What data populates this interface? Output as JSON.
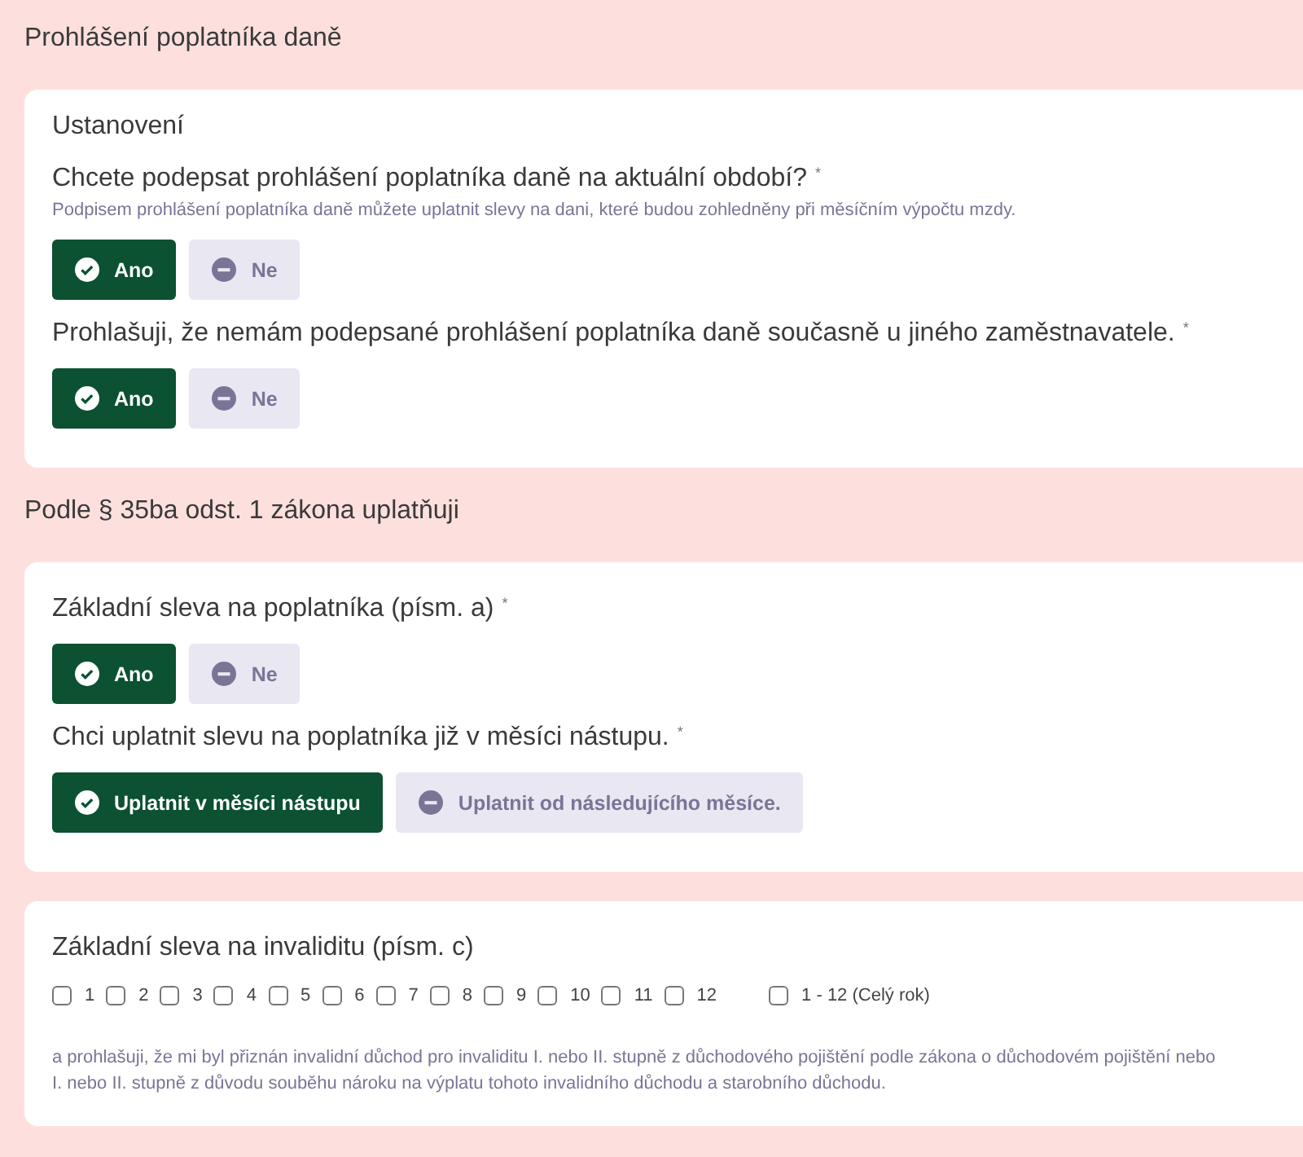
{
  "sections": [
    {
      "title": "Prohlášení poplatníka daně",
      "cards": [
        {
          "title": "Ustanovení",
          "questions": [
            {
              "kind": "choice",
              "label": "Chcete podepsat prohlášení poplatníka daně na aktuální období?",
              "required_mark": "*",
              "hint": "Podpisem prohlášení poplatníka daně můžete uplatnit slevy na dani, které budou zohledněny při měsíčním výpočtu mzdy.",
              "options": [
                {
                  "label": "Ano",
                  "selected": true
                },
                {
                  "label": "Ne",
                  "selected": false
                }
              ]
            },
            {
              "kind": "choice",
              "label": "Prohlašuji, že nemám podepsané prohlášení poplatníka daně současně u jiného zaměstnavatele.",
              "required_mark": "*",
              "options": [
                {
                  "label": "Ano",
                  "selected": true
                },
                {
                  "label": "Ne",
                  "selected": false
                }
              ]
            }
          ]
        }
      ]
    },
    {
      "title": "Podle § 35ba odst. 1 zákona uplatňuji",
      "cards": [
        {
          "questions": [
            {
              "kind": "choice",
              "label": "Základní sleva na poplatníka (písm. a)",
              "required_mark": "*",
              "options": [
                {
                  "label": "Ano",
                  "selected": true
                },
                {
                  "label": "Ne",
                  "selected": false
                }
              ]
            },
            {
              "kind": "choice",
              "label": "Chci uplatnit slevu na poplatníka již v měsíci nástupu.",
              "required_mark": "*",
              "options": [
                {
                  "label": "Uplatnit v měsíci nástupu",
                  "selected": true
                },
                {
                  "label": "Uplatnit od následujícího měsíce.",
                  "selected": false
                }
              ]
            }
          ]
        },
        {
          "questions": [
            {
              "kind": "months",
              "label": "Základní sleva na invaliditu (písm. c)",
              "months": [
                {
                  "label": "1",
                  "checked": false
                },
                {
                  "label": "2",
                  "checked": false
                },
                {
                  "label": "3",
                  "checked": false
                },
                {
                  "label": "4",
                  "checked": false
                },
                {
                  "label": "5",
                  "checked": false
                },
                {
                  "label": "6",
                  "checked": false
                },
                {
                  "label": "7",
                  "checked": false
                },
                {
                  "label": "8",
                  "checked": false
                },
                {
                  "label": "9",
                  "checked": false
                },
                {
                  "label": "10",
                  "checked": false
                },
                {
                  "label": "11",
                  "checked": false
                },
                {
                  "label": "12",
                  "checked": false
                }
              ],
              "whole_year": {
                "label": "1 - 12 (Celý rok)",
                "checked": false
              },
              "note_lines": [
                "a prohlašuji, že mi byl přiznán invalidní důchod pro invaliditu I. nebo II. stupně z důchodového pojištění podle zákona o důchodovém pojištění nebo",
                "I. nebo II. stupně z důvodu souběhu nároku na výplatu tohoto invalidního důchodu a starobního důchodu."
              ]
            }
          ]
        }
      ]
    }
  ]
}
